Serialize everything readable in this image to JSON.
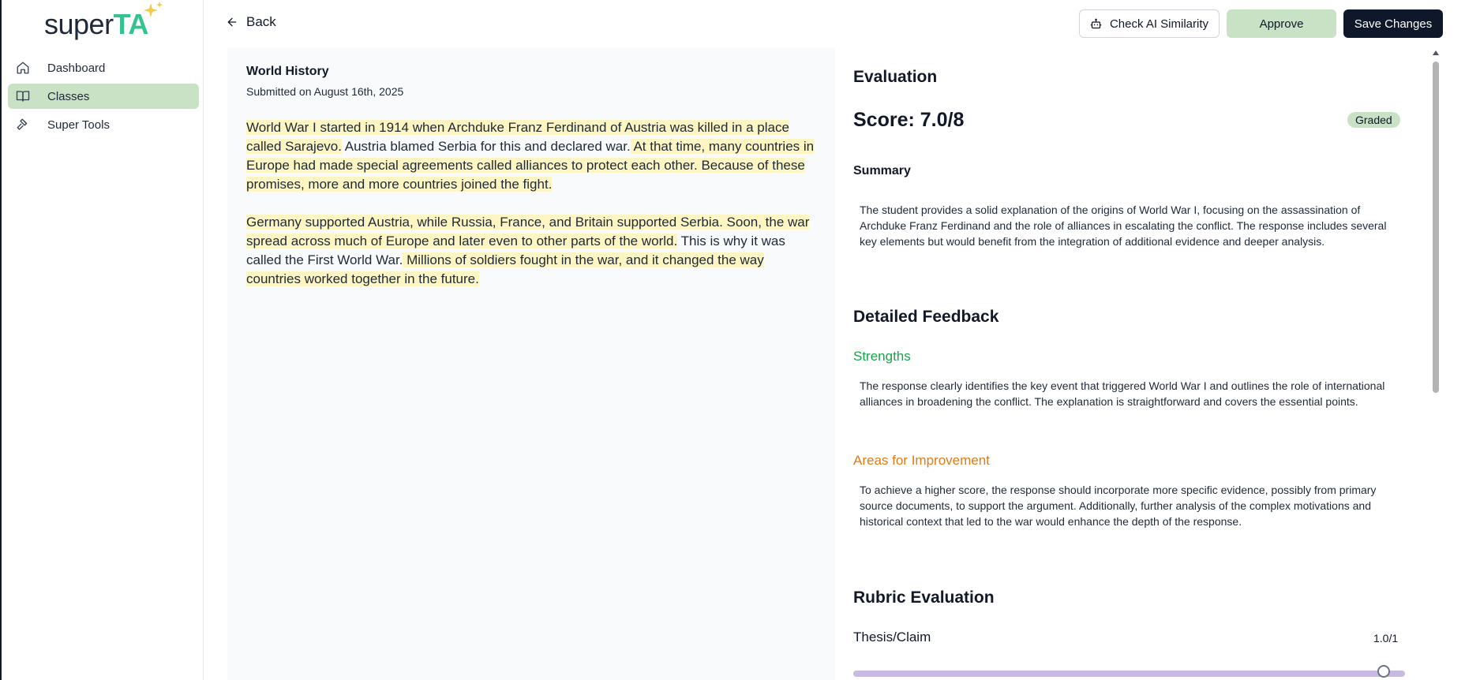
{
  "sidebar": {
    "logo": {
      "part1": "super",
      "part2": "TA"
    },
    "items": [
      {
        "label": "Dashboard",
        "icon": "home-icon",
        "active": false
      },
      {
        "label": "Classes",
        "icon": "book-icon",
        "active": true
      },
      {
        "label": "Super Tools",
        "icon": "hammer-icon",
        "active": false
      }
    ]
  },
  "topbar": {
    "back_label": "Back",
    "check_ai_label": "Check AI Similarity",
    "approve_label": "Approve",
    "save_label": "Save Changes"
  },
  "submission": {
    "title": "World History",
    "date": "Submitted on August 16th, 2025",
    "paragraphs": [
      [
        {
          "text": "World War I started in 1914 when Archduke Franz Ferdinand of Austria was killed in a place called Sarajevo.",
          "highlight": true
        },
        {
          "text": " Austria blamed Serbia for this and declared war.",
          "highlight": false
        },
        {
          "text": " At that time, many countries in Europe had made special agreements called alliances to protect each other. Because of these promises, more and more countries joined the fight.",
          "highlight": true
        }
      ],
      [
        {
          "text": "Germany supported Austria, while Russia, France, and Britain supported Serbia. Soon, the war spread across much of Europe and later even to other parts of the world.",
          "highlight": true
        },
        {
          "text": " This is why it was called the First World War.",
          "highlight": false
        },
        {
          "text": " Millions of soldiers fought in the war, and it changed the way countries worked together in the future.",
          "highlight": true
        }
      ]
    ]
  },
  "evaluation": {
    "title": "Evaluation",
    "score": "Score: 7.0/8",
    "status": "Graded",
    "summary_heading": "Summary",
    "summary_text": "The student provides a solid explanation of the origins of World War I, focusing on the assassination of Archduke Franz Ferdinand and the role of alliances in escalating the conflict. The response includes several key elements but would benefit from the integration of additional evidence and deeper analysis.",
    "detailed_heading": "Detailed Feedback",
    "strengths_heading": "Strengths",
    "strengths_text": "The response clearly identifies the key event that triggered World War I and outlines the role of international alliances in broadening the conflict. The explanation is straightforward and covers the essential points.",
    "improvement_heading": "Areas for Improvement",
    "improvement_text": "To achieve a higher score, the response should incorporate more specific evidence, possibly from primary source documents, to support the argument. Additionally, further analysis of the complex motivations and historical context that led to the war would enhance the depth of the response.",
    "rubric_heading": "Rubric Evaluation",
    "rubric_items": [
      {
        "name": "Thesis/Claim",
        "score": "1.0/1",
        "value": 1.0
      }
    ]
  },
  "colors": {
    "accent_green": "#c9e2c6",
    "brand_green": "#34c38f",
    "dark_button": "#0f172a",
    "highlight": "#fdf6c3",
    "strengths": "#16a34a",
    "improvement": "#e07b16",
    "slider": "#c9b8e3"
  }
}
